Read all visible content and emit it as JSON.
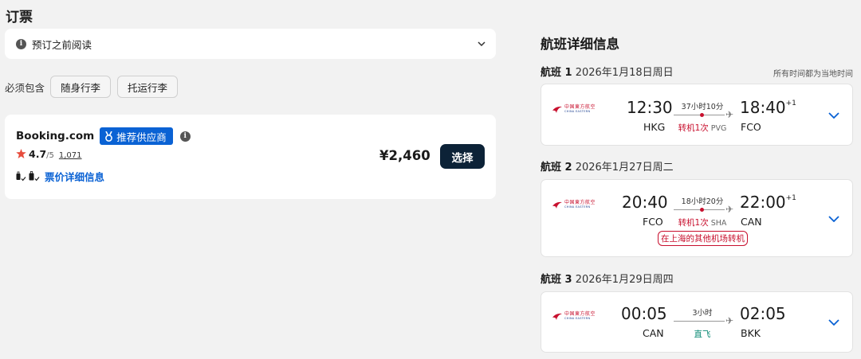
{
  "page_title": "订票",
  "notice": {
    "label": "预订之前阅读",
    "info_icon": "i"
  },
  "required": {
    "label": "必须包含",
    "chips": [
      "随身行李",
      "托运行李"
    ]
  },
  "offer": {
    "provider": "Booking.com",
    "badge": "推荐供应商",
    "rating": "4.7",
    "rating_max": "/5",
    "rating_count": "1,071",
    "fare_link": "票价详细信息",
    "price": "¥2,460",
    "select_label": "选择"
  },
  "details": {
    "title": "航班详细信息",
    "local_time_note": "所有时间都为当地时间"
  },
  "airline": {
    "logo_cn": "中国東方航空",
    "logo_en": "CHINA EASTERN",
    "logo_color": "#c8102e"
  },
  "flights": [
    {
      "label": "航班 1",
      "date": "2026年1月18日周日",
      "dep_time": "12:30",
      "dep_code": "HKG",
      "arr_time": "18:40",
      "arr_plus": "+1",
      "arr_code": "FCO",
      "duration": "37小时10分",
      "stops": "转机1次",
      "stop_airport": "PVG"
    },
    {
      "label": "航班 2",
      "date": "2026年1月27日周二",
      "dep_time": "20:40",
      "dep_code": "FCO",
      "arr_time": "22:00",
      "arr_plus": "+1",
      "arr_code": "CAN",
      "duration": "18小时20分",
      "stops": "转机1次",
      "stop_airport": "SHA",
      "airport_change": "在上海的其他机场转机"
    },
    {
      "label": "航班 3",
      "date": "2026年1月29日周四",
      "dep_time": "00:05",
      "dep_code": "CAN",
      "arr_time": "02:05",
      "arr_code": "BKK",
      "duration": "3小时",
      "direct": "直飞"
    }
  ],
  "colors": {
    "accent_blue": "#0a62d4",
    "stop_red": "#c8102e",
    "direct_green": "#0c8a75",
    "button_dark": "#0c2237"
  }
}
